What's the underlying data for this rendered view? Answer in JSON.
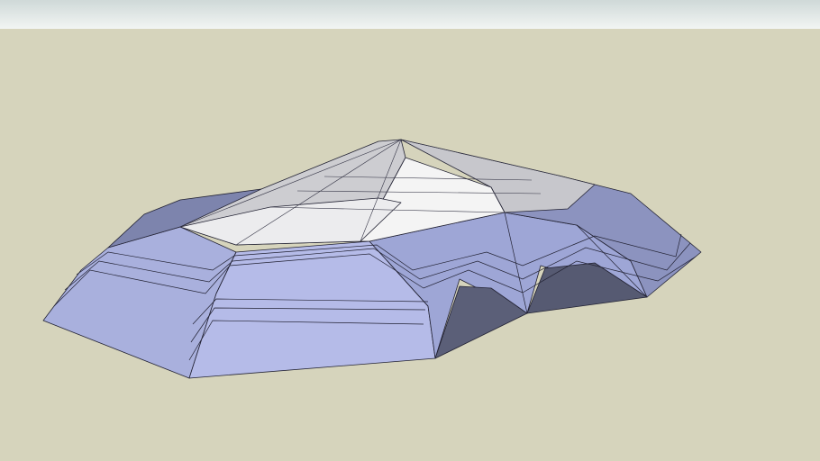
{
  "scene": {
    "sky_colors": [
      "#cfd9d8",
      "#f2f5f3"
    ],
    "ground_color": "#d6d4bc",
    "model_colors": {
      "outer_light": "#c4c8f0",
      "outer_mid": "#9fa6cf",
      "outer_dark": "#7d84ad",
      "cavity": "#5a5e76",
      "top_white": "#f6f6f6",
      "top_grey": "#cfcfd2",
      "edge": "#222233"
    }
  }
}
